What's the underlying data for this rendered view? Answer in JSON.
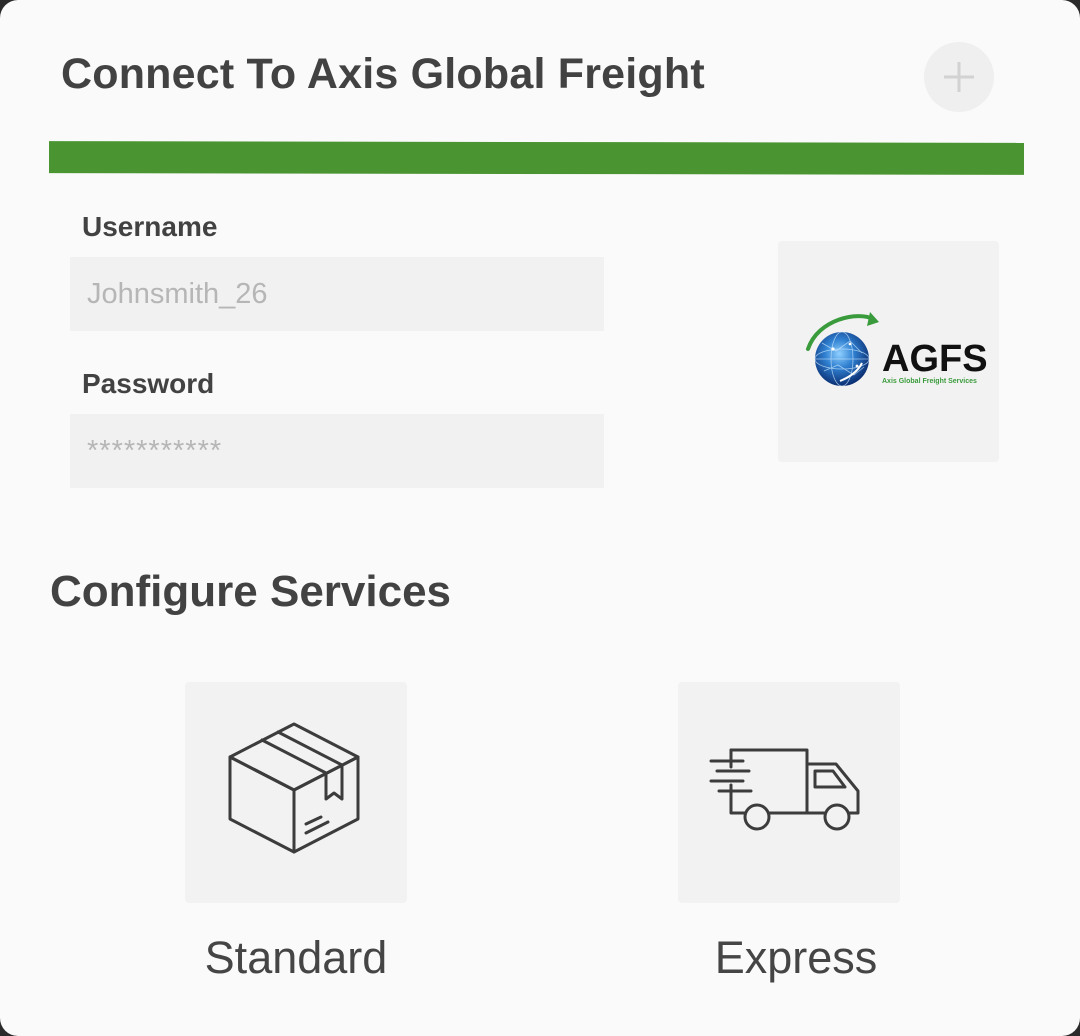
{
  "header": {
    "title": "Connect To Axis Global Freight",
    "add_icon": "plus-icon"
  },
  "colors": {
    "accent": "#4a9431",
    "text": "#424242",
    "field_bg": "#f1f1f1"
  },
  "form": {
    "username_label": "Username",
    "username_placeholder": "Johnsmith_26",
    "password_label": "Password",
    "password_placeholder": "***********"
  },
  "logo": {
    "wordmark": "AGFS",
    "tagline": "Axis Global Freight Services"
  },
  "services": {
    "title": "Configure Services",
    "items": [
      {
        "label": "Standard",
        "icon": "box-icon"
      },
      {
        "label": "Express",
        "icon": "delivery-truck-icon"
      }
    ]
  }
}
